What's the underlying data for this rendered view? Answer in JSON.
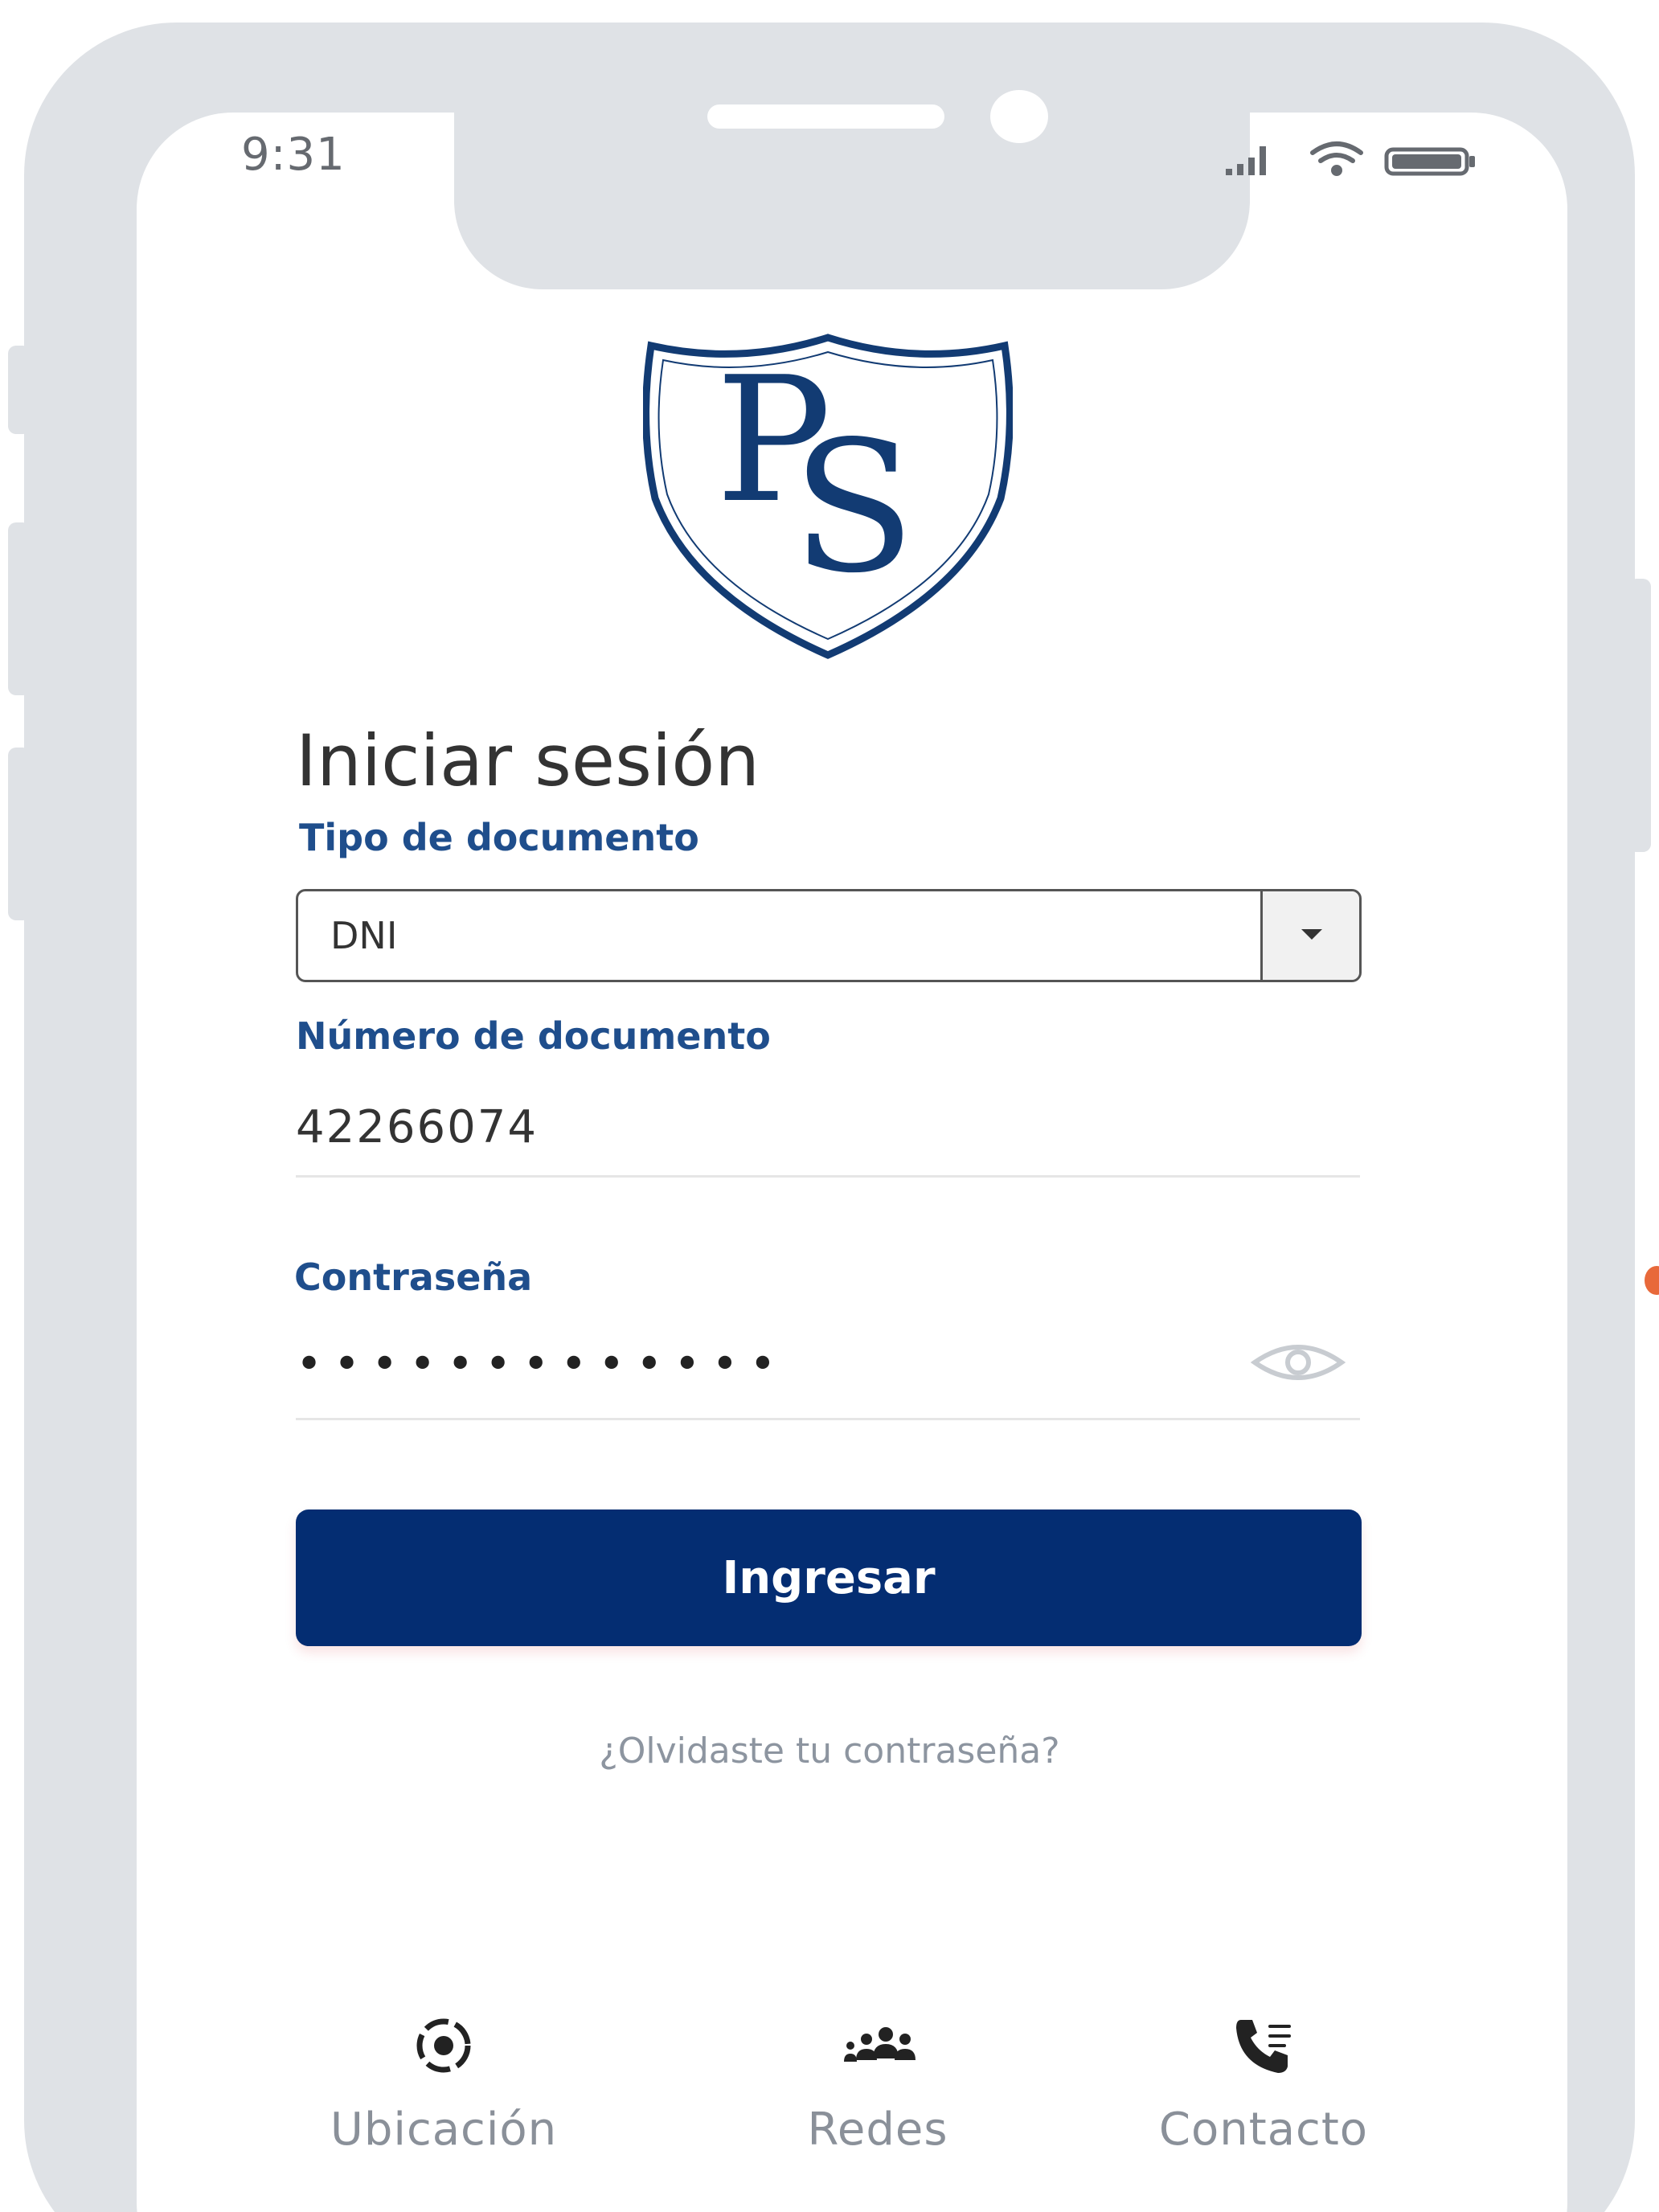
{
  "status_bar": {
    "time": "9:31"
  },
  "logo": {
    "letters": "PS",
    "color": "#123b73"
  },
  "login": {
    "title": "Iniciar sesión",
    "document_type": {
      "label": "Tipo de documento",
      "selected": "DNI"
    },
    "document_number": {
      "label": "Número de documento",
      "value": "42266074"
    },
    "password": {
      "label": "Contraseña",
      "masked_value": "•••••••••••••"
    },
    "submit_label": "Ingresar",
    "forgot_password": "¿Olvidaste tu contraseña?"
  },
  "bottom_nav": {
    "items": [
      {
        "label": "Ubicación",
        "icon": "location-icon"
      },
      {
        "label": "Redes",
        "icon": "people-icon"
      },
      {
        "label": "Contacto",
        "icon": "phone-icon"
      }
    ]
  },
  "colors": {
    "primary": "#042d72",
    "label_blue": "#1f4e8c",
    "frame": "#dfe2e6",
    "muted_text": "#8a9099"
  }
}
